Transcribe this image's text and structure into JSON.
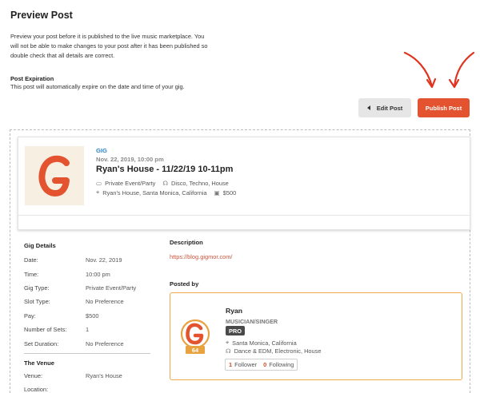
{
  "header": {
    "title": "Preview Post",
    "intro_line1": "Preview your post before it is published to the live music marketplace. You",
    "intro_line2": "will not be able to make changes to your post after it has been published so",
    "intro_line3": "double check that all details are correct.",
    "expiration_title": "Post Expiration",
    "expiration_text": "This post will automatically expire on the date and time of your gig."
  },
  "actions": {
    "edit_label": "Edit Post",
    "publish_label": "Publish Post"
  },
  "colors": {
    "accent": "#e4532f",
    "link": "#2a84c6",
    "profile_border": "#eea94b"
  },
  "gig_card": {
    "type": "GIG",
    "datetime": "Nov. 22, 2019, 10:00 pm",
    "title": "Ryan's House - 11/22/19 10-11pm",
    "gig_type": "Private Event/Party",
    "genres": "Disco, Techno, House",
    "location": "Ryan's House, Santa Monica, California",
    "pay": "$500",
    "icons": [
      "event-icon",
      "headphones-icon",
      "location-pin-icon",
      "money-icon"
    ]
  },
  "gig_details": {
    "title": "Gig Details",
    "rows": [
      {
        "label": "Date:",
        "value": "Nov. 22, 2019"
      },
      {
        "label": "Time:",
        "value": "10:00 pm"
      },
      {
        "label": "Gig Type:",
        "value": "Private Event/Party"
      },
      {
        "label": "Slot Type:",
        "value": "No Preference"
      },
      {
        "label": "Pay:",
        "value": "$500"
      },
      {
        "label": "Number of Sets:",
        "value": "1"
      },
      {
        "label": "Set Duration:",
        "value": "No Preference"
      }
    ]
  },
  "venue": {
    "title": "The Venue",
    "rows": [
      {
        "label": "Venue:",
        "value": "Ryan's House"
      },
      {
        "label": "Location:",
        "value": ""
      }
    ]
  },
  "description": {
    "title": "Description",
    "link": "https://blog.gigmor.com/"
  },
  "posted_by": {
    "title": "Posted by",
    "name": "Ryan",
    "role": "MUSICIAN/SINGER",
    "badge": "PRO",
    "score": "64",
    "location": "Santa Monica, California",
    "genres": "Dance & EDM, Electronic, House",
    "followers_count": "1",
    "followers_label": "Follower",
    "following_count": "0",
    "following_label": "Following"
  }
}
